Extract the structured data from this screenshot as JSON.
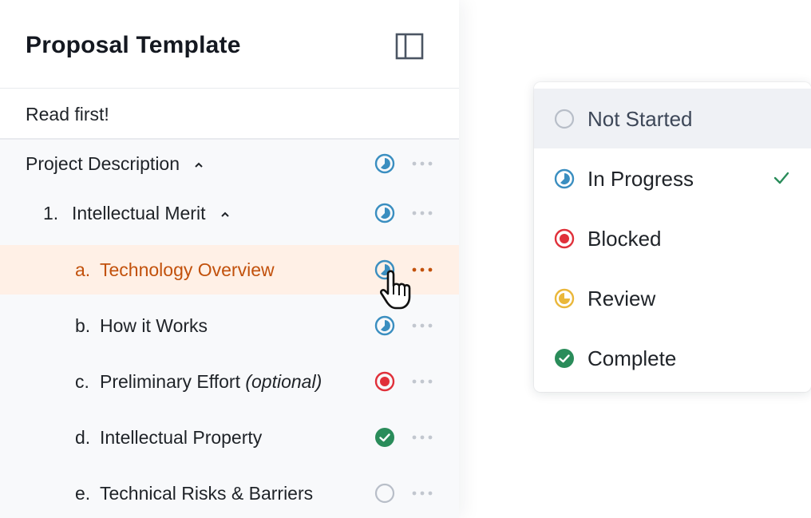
{
  "panel": {
    "title": "Proposal Template",
    "read_first": "Read first!",
    "rows": [
      {
        "num": "",
        "label": "Project Description",
        "suffix": "",
        "status": "in-progress",
        "expanded": true
      },
      {
        "num": "1.",
        "label": "Intellectual Merit",
        "suffix": "",
        "status": "in-progress",
        "expanded": true
      },
      {
        "num": "a.",
        "label": "Technology Overview",
        "suffix": "",
        "status": "in-progress",
        "active": true
      },
      {
        "num": "b.",
        "label": "How it Works",
        "suffix": "",
        "status": "in-progress"
      },
      {
        "num": "c.",
        "label": "Preliminary Effort",
        "suffix": "(optional)",
        "status": "blocked"
      },
      {
        "num": "d.",
        "label": "Intellectual Property",
        "suffix": "",
        "status": "complete"
      },
      {
        "num": "e.",
        "label": "Technical Risks & Barriers",
        "suffix": "",
        "status": "not-started"
      }
    ]
  },
  "status_menu": {
    "options": [
      {
        "label": "Not Started",
        "status": "not-started",
        "hovered": true
      },
      {
        "label": "In Progress",
        "status": "in-progress",
        "selected": true
      },
      {
        "label": "Blocked",
        "status": "blocked"
      },
      {
        "label": "Review",
        "status": "review"
      },
      {
        "label": "Complete",
        "status": "complete"
      }
    ]
  },
  "colors": {
    "in_progress": "#3a8ec0",
    "blocked": "#e0303a",
    "review": "#eab73a",
    "complete": "#2a8c5a",
    "not_started": "#b8bec8",
    "active_text": "#c2510c",
    "active_bg": "#fff0e6",
    "check": "#2a8c5a"
  }
}
